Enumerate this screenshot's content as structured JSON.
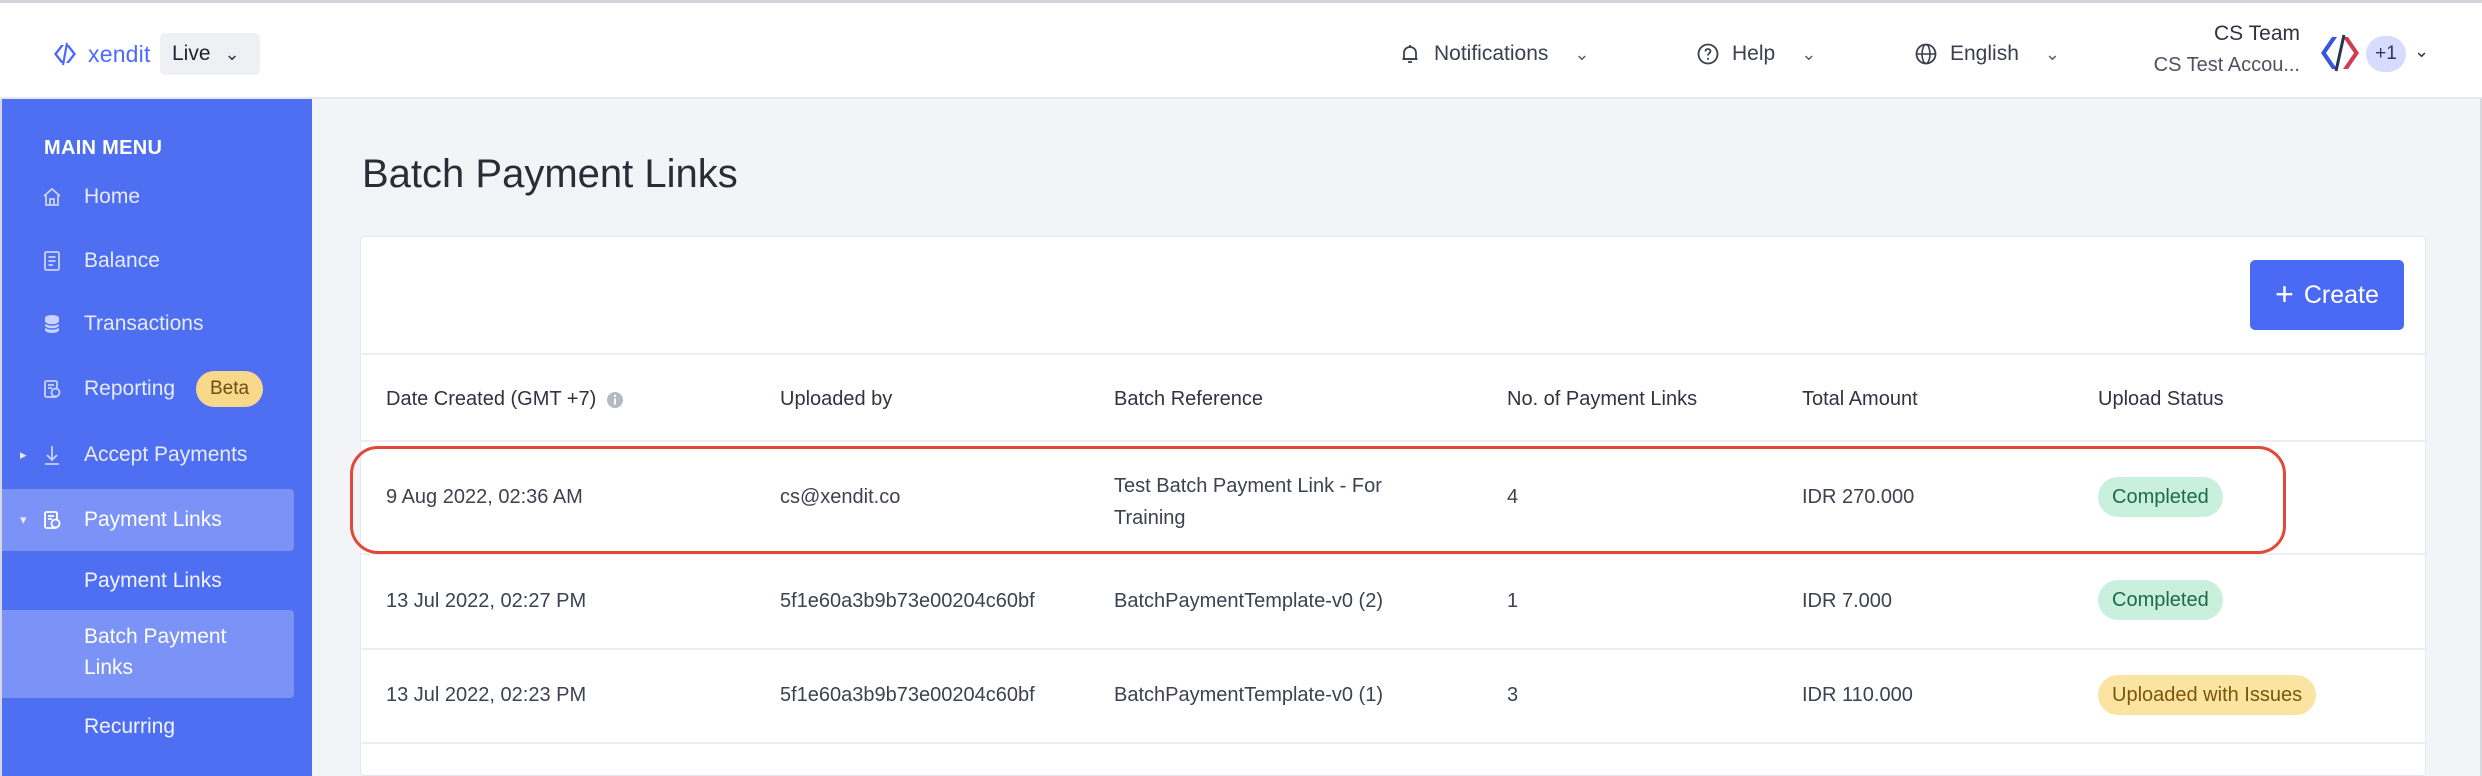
{
  "topbar": {
    "logo_text": "xendit",
    "environment": "Live",
    "notifications_label": "Notifications",
    "help_label": "Help",
    "language_label": "English",
    "user_name": "CS Team",
    "user_account": "CS Test Accou...",
    "account_count": "+1"
  },
  "sidebar": {
    "menu_title": "MAIN MENU",
    "items": [
      {
        "label": "Home",
        "icon": "home-icon"
      },
      {
        "label": "Balance",
        "icon": "document-icon"
      },
      {
        "label": "Transactions",
        "icon": "coins-icon"
      },
      {
        "label": "Reporting",
        "icon": "report-icon",
        "badge": "Beta"
      },
      {
        "label": "Accept Payments",
        "icon": "arrow-down-icon"
      },
      {
        "label": "Payment Links",
        "icon": "link-doc-icon"
      }
    ],
    "sub_items": [
      {
        "label": "Payment Links"
      },
      {
        "label_line1": "Batch Payment",
        "label_line2": "Links"
      },
      {
        "label": "Recurring"
      }
    ]
  },
  "main": {
    "page_title": "Batch Payment Links",
    "create_label": "Create",
    "table": {
      "headers": [
        "Date Created (GMT +7)",
        "Uploaded by",
        "Batch Reference",
        "No. of Payment Links",
        "Total Amount",
        "Upload Status"
      ],
      "rows": [
        {
          "date": "9 Aug 2022, 02:36 AM",
          "uploaded_by": "cs@xendit.co",
          "ref_line1": "Test Batch Payment Link - For",
          "ref_line2": "Training",
          "count": "4",
          "amount": "IDR 270.000",
          "status": "Completed"
        },
        {
          "date": "13 Jul 2022, 02:27 PM",
          "uploaded_by": "5f1e60a3b9b73e00204c60bf",
          "ref_line1": "BatchPaymentTemplate-v0 (2)",
          "count": "1",
          "amount": "IDR 7.000",
          "status": "Completed"
        },
        {
          "date": "13 Jul 2022, 02:23 PM",
          "uploaded_by": "5f1e60a3b9b73e00204c60bf",
          "ref_line1": "BatchPaymentTemplate-v0 (1)",
          "count": "3",
          "amount": "IDR 110.000",
          "status": "Uploaded with Issues"
        }
      ]
    }
  },
  "colors": {
    "brand": "#4f6ff2",
    "primary_button": "#4a6af5",
    "status_completed_bg": "#c8f0dd",
    "status_issue_bg": "#fbe3a1",
    "highlight_outline": "#e0483a"
  }
}
